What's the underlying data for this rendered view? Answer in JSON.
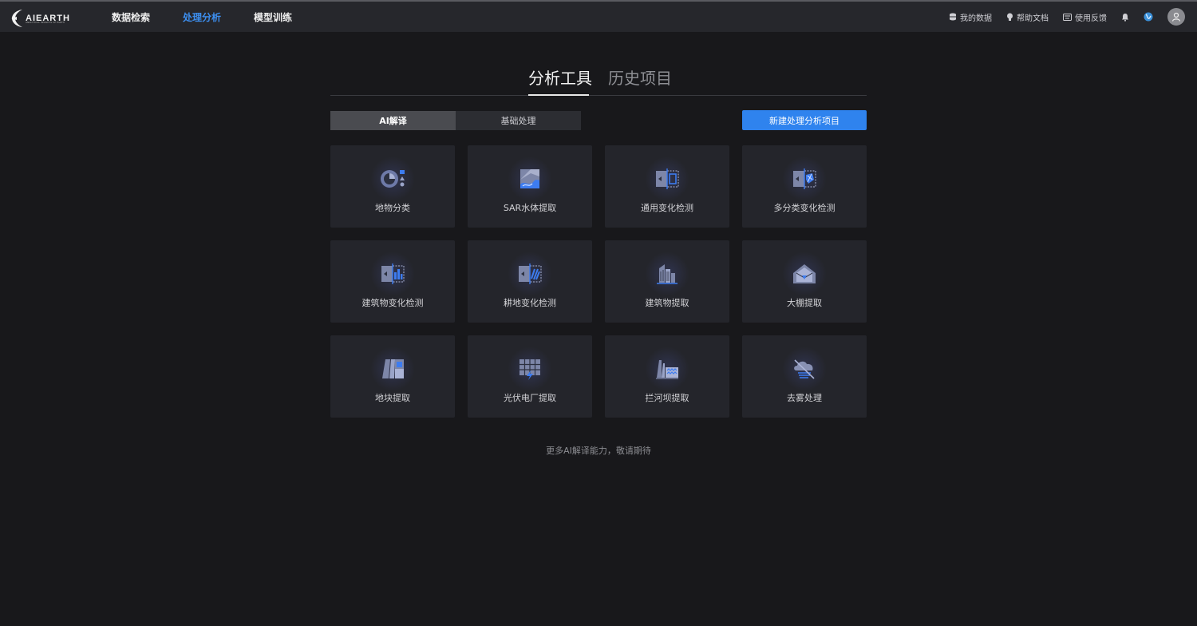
{
  "logo": {
    "text": "AIEARTH",
    "subtitle": "ANALYTICAL INSIGHTS OF EARTH"
  },
  "nav": {
    "items": [
      "数据检索",
      "处理分析",
      "模型训练"
    ],
    "active_index": 1
  },
  "top_right": {
    "my_data": "我的数据",
    "help_docs": "帮助文档",
    "feedback": "使用反馈"
  },
  "main_tabs": [
    "分析工具",
    "历史项目"
  ],
  "sub_tabs": [
    "AI解译",
    "基础处理"
  ],
  "new_button": "新建处理分析项目",
  "tools": [
    {
      "label": "地物分类",
      "icon": "land-classification-icon"
    },
    {
      "label": "SAR水体提取",
      "icon": "sar-water-icon"
    },
    {
      "label": "通用变化检测",
      "icon": "general-change-icon"
    },
    {
      "label": "多分类变化检测",
      "icon": "multi-class-change-icon"
    },
    {
      "label": "建筑物变化检测",
      "icon": "building-change-icon"
    },
    {
      "label": "耕地变化检测",
      "icon": "farmland-change-icon"
    },
    {
      "label": "建筑物提取",
      "icon": "building-extract-icon"
    },
    {
      "label": "大棚提取",
      "icon": "greenhouse-icon"
    },
    {
      "label": "地块提取",
      "icon": "parcel-icon"
    },
    {
      "label": "光伏电厂提取",
      "icon": "solar-plant-icon"
    },
    {
      "label": "拦河坝提取",
      "icon": "dam-icon"
    },
    {
      "label": "去雾处理",
      "icon": "dehaze-icon"
    }
  ],
  "footer_note": "更多AI解译能力，敬请期待",
  "colors": {
    "accent": "#2f83ee",
    "nav_active": "#3d8ff0",
    "background": "#18181b",
    "card": "#24252b"
  }
}
